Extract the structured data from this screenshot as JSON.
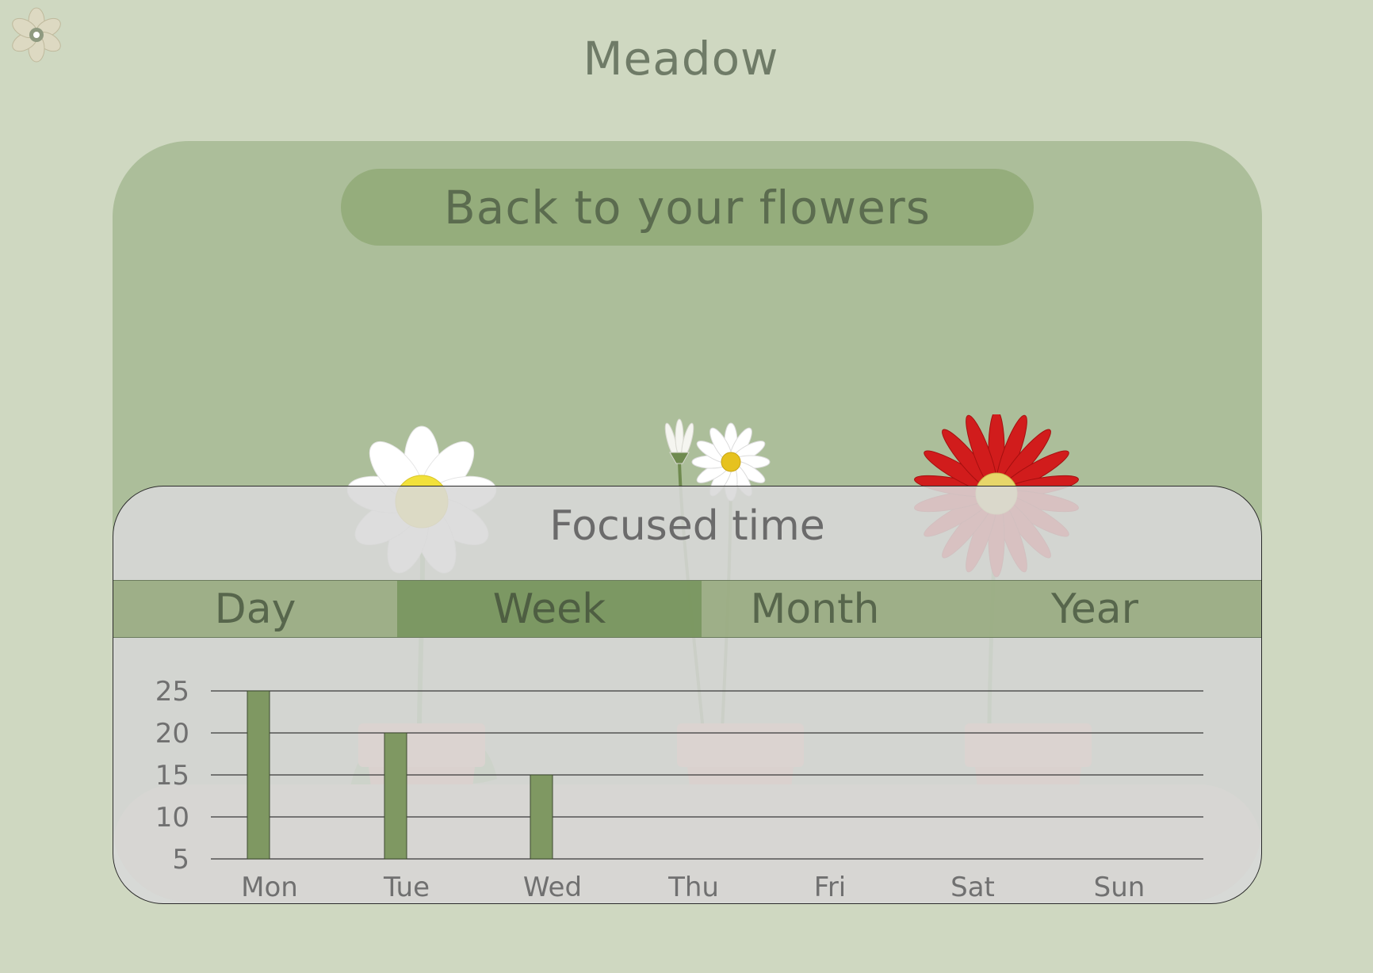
{
  "app": {
    "title": "Meadow",
    "logo_icon": "flower-logo-icon"
  },
  "garden": {
    "back_label": "Back to your flowers",
    "flowers": [
      "white-daisy",
      "small-daisies",
      "red-gerbera"
    ]
  },
  "stats": {
    "title": "Focused time",
    "tabs": [
      {
        "label": "Day",
        "active": false
      },
      {
        "label": "Week",
        "active": true
      },
      {
        "label": "Month",
        "active": false
      },
      {
        "label": "Year",
        "active": false
      }
    ]
  },
  "chart_data": {
    "type": "bar",
    "categories": [
      "Mon",
      "Tue",
      "Wed",
      "Thu",
      "Fri",
      "Sat",
      "Sun"
    ],
    "values": [
      25,
      20,
      15,
      0,
      0,
      0,
      0
    ],
    "yticks": [
      5,
      10,
      15,
      20,
      25
    ],
    "ylim": [
      5,
      25
    ],
    "grid": true,
    "bar_color": "#7f9862"
  },
  "colors": {
    "background": "#cfd8c1",
    "card": "#acbe9a",
    "accent": "#7f9862"
  }
}
